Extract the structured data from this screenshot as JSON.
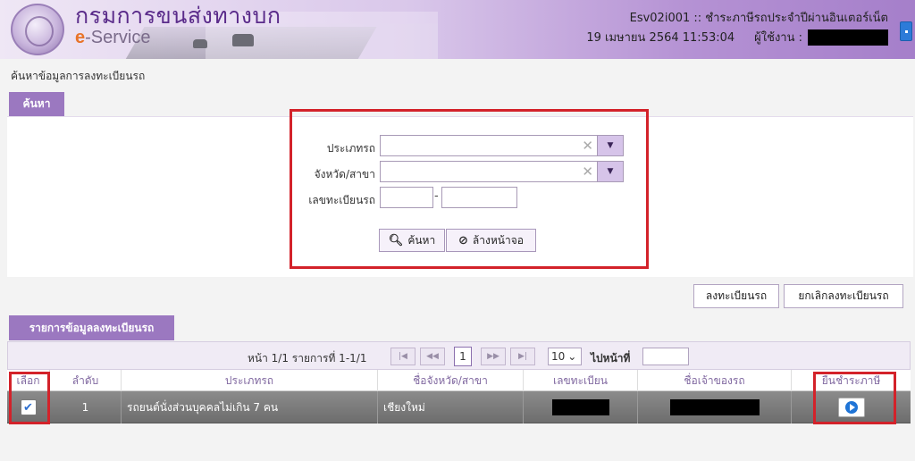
{
  "header": {
    "logo_title": "กรมการขนส่งทางบก",
    "logo_sub_e": "e",
    "logo_sub_rest": "-Service",
    "screen_code": "Esv02i001 :: ชำระภาษีรถประจำปีผ่านอินเตอร์เน็ต",
    "datetime": "19 เมษายน 2564 11:53:04",
    "user_label": "ผู้ใช้งาน :"
  },
  "breadcrumb": "ค้นหาข้อมูลการลงทะเบียนรถ",
  "search": {
    "tab_label": "ค้นหา",
    "vehicle_type_label": "ประเภทรถ",
    "province_label": "จังหวัด/สาขา",
    "plate_label": "เลขทะเบียนรถ",
    "plate_dash": "-",
    "clear_glyph": "✕",
    "dropdown_glyph": "▼",
    "search_button": "ค้นหา",
    "reset_button": "ล้างหน้าจอ"
  },
  "actions": {
    "register_button": "ลงทะเบียนรถ",
    "cancel_register_button": "ยกเลิกลงทะเบียนรถ"
  },
  "list": {
    "tab_label": "รายการข้อมูลลงทะเบียนรถ",
    "pager_text": "หน้า 1/1 รายการที่ 1-1/1",
    "first_glyph": "|◀",
    "prev_glyph": "◀◀",
    "current_page": "1",
    "next_glyph": "▶▶",
    "last_glyph": "▶|",
    "page_size": "10",
    "page_size_arrow": "⌄",
    "goto_label": "ไปหน้าที่",
    "columns": [
      "เลือก",
      "ลำดับ",
      "ประเภทรถ",
      "ชื่อจังหวัด/สาขา",
      "เลขทะเบียน",
      "ชื่อเจ้าของรถ",
      "ยื่นชำระภาษี"
    ],
    "rows": [
      {
        "checked": "✔",
        "index": "1",
        "vehicle_type": "รถยนต์นั่งส่วนบุคคลไม่เกิน 7 คน",
        "province": "เชียงใหม่"
      }
    ]
  },
  "colors": {
    "accent": "#9b78c0",
    "highlight_red": "#d3222a",
    "row_selected": "#777777",
    "action_icon": "#1f74d6"
  }
}
